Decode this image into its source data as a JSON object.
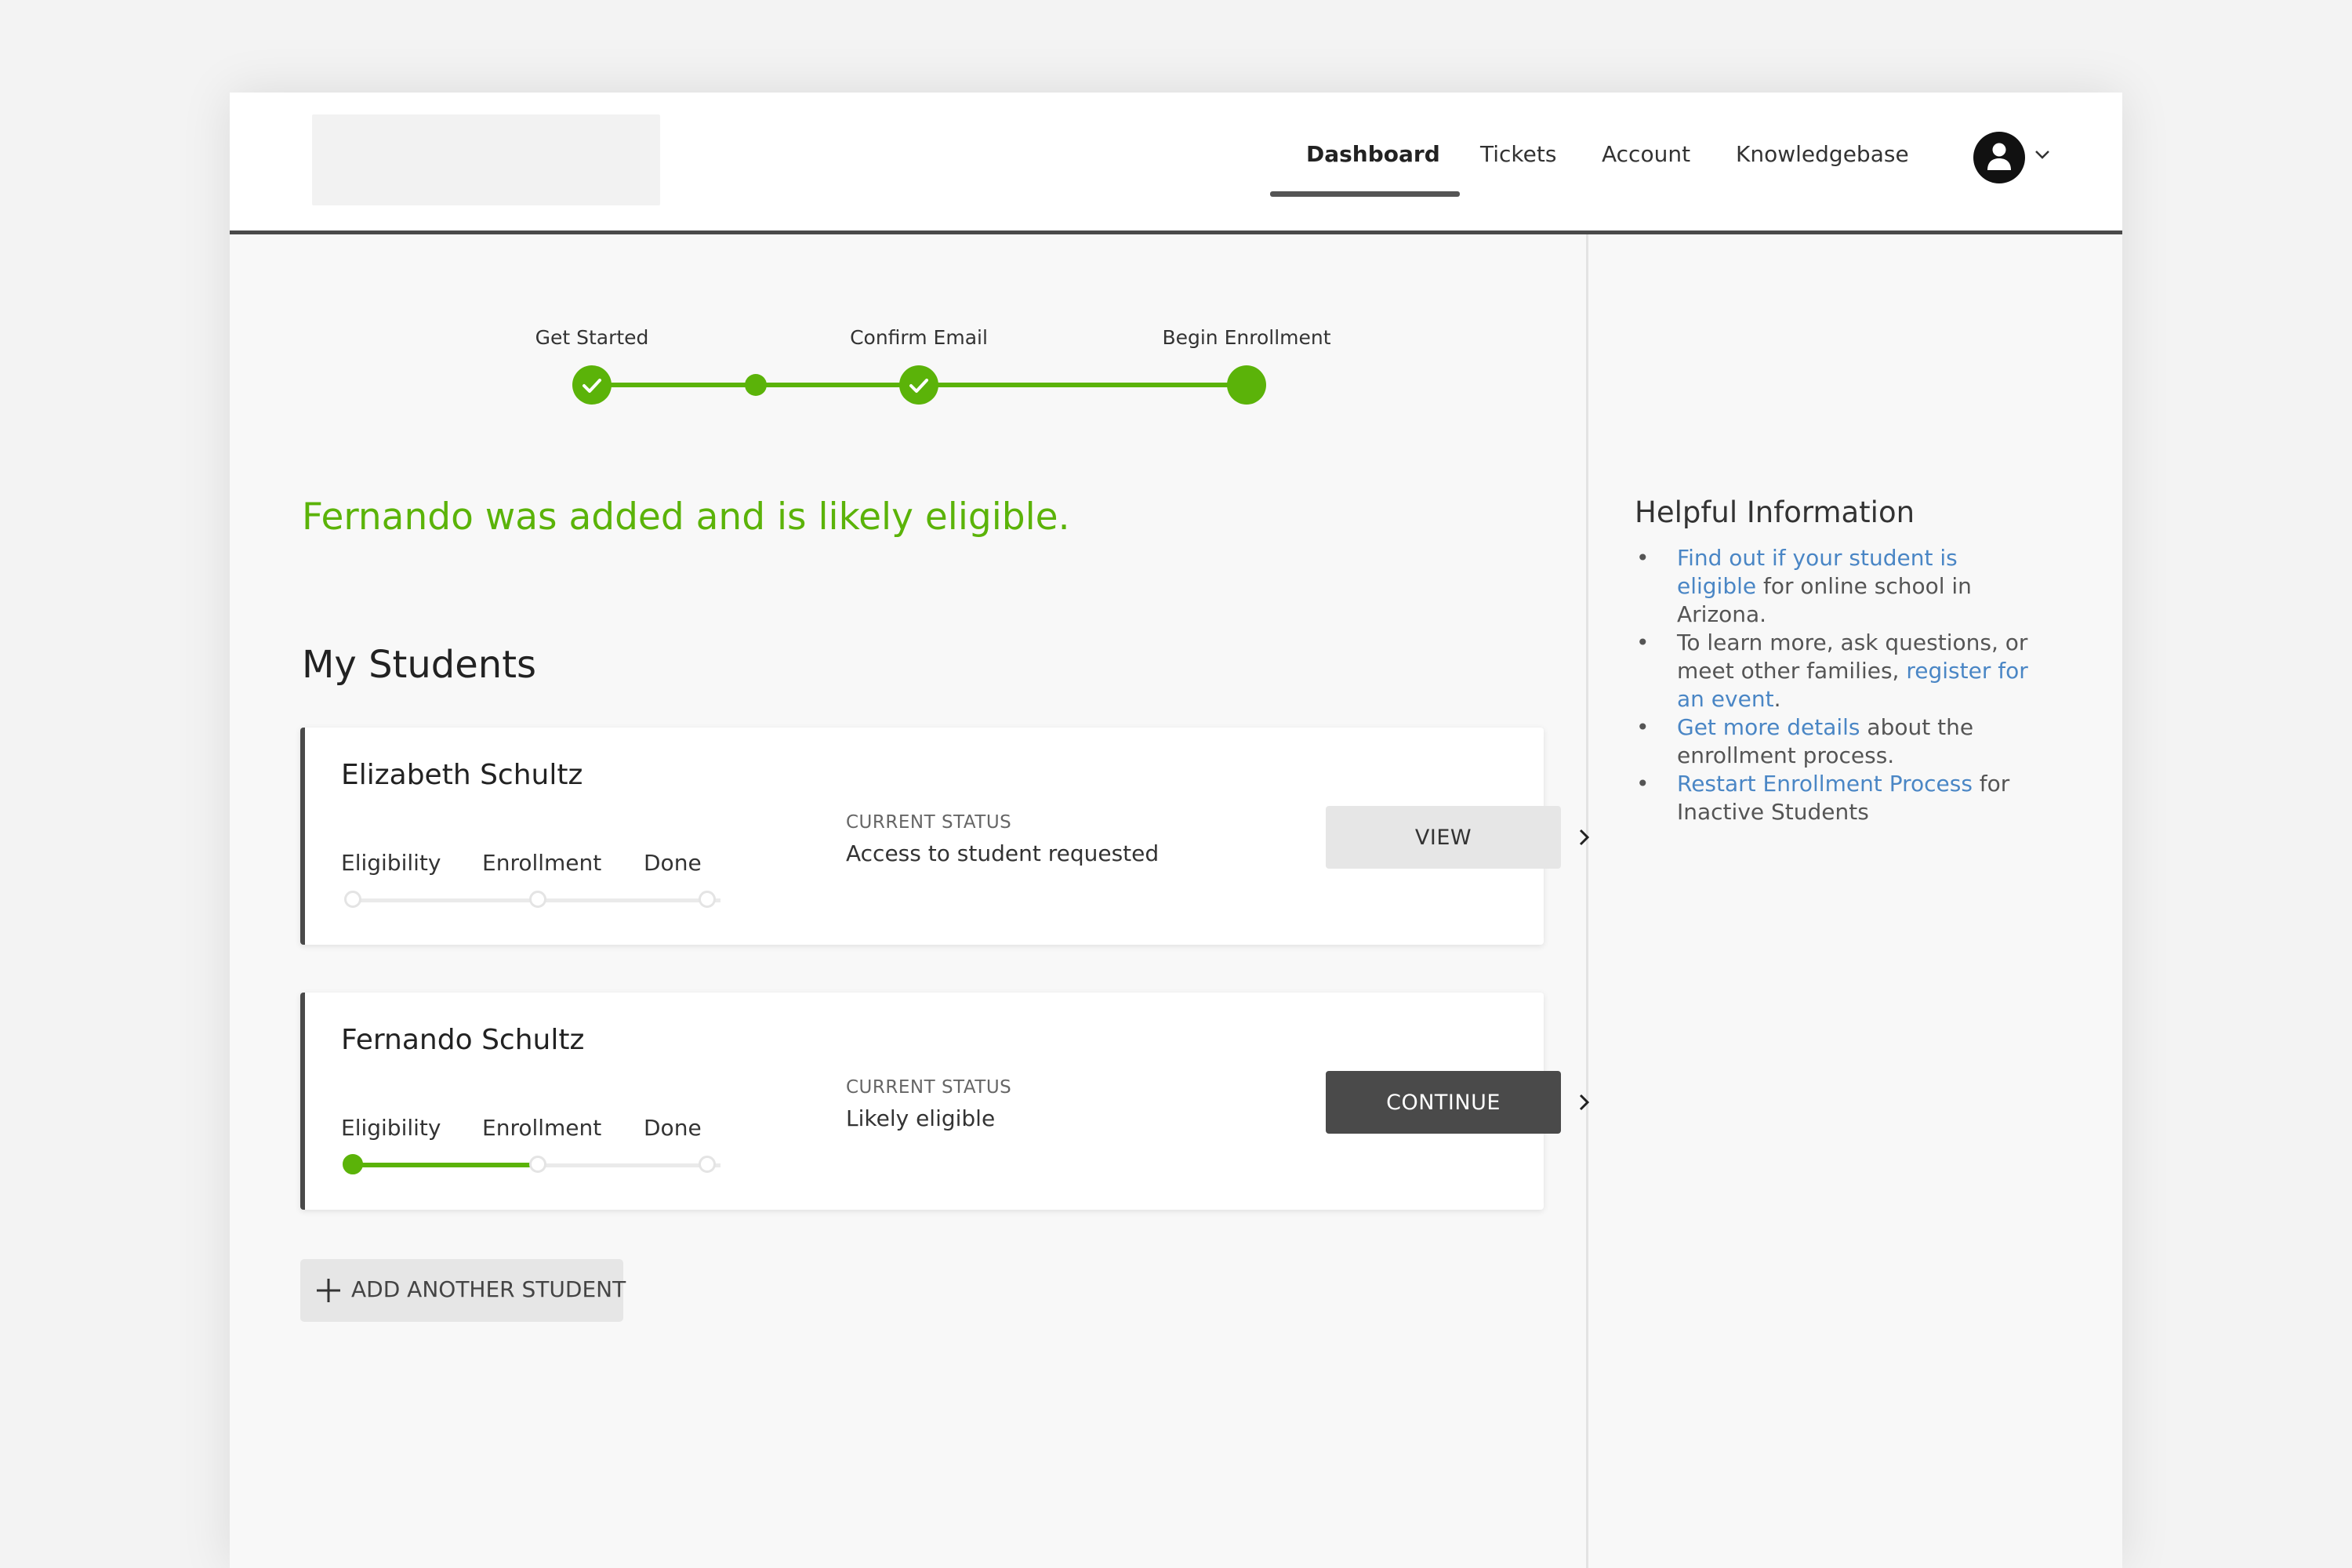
{
  "nav": {
    "items": [
      {
        "label": "Dashboard",
        "active": true
      },
      {
        "label": "Tickets",
        "active": false
      },
      {
        "label": "Account",
        "active": false
      },
      {
        "label": "Knowledgebase",
        "active": false
      }
    ],
    "user_icon": "user-avatar-icon",
    "dropdown_icon": "chevron-down-icon"
  },
  "stepper": {
    "steps": [
      {
        "label": "Get Started",
        "state": "complete"
      },
      {
        "label": "",
        "state": "intermediate"
      },
      {
        "label": "Confirm Email",
        "state": "complete"
      },
      {
        "label": "Begin Enrollment",
        "state": "current"
      }
    ]
  },
  "message": "Fernando was added and is likely eligible.",
  "students_title": "My Students",
  "students": [
    {
      "name": "Elizabeth Schultz",
      "progress_labels": [
        "Eligibility",
        "Enrollment",
        "Done"
      ],
      "progress_completed": 0,
      "status_label": "CURRENT STATUS",
      "status": "Access to student requested",
      "action": "VIEW",
      "action_style": "light"
    },
    {
      "name": "Fernando Schultz",
      "progress_labels": [
        "Eligibility",
        "Enrollment",
        "Done"
      ],
      "progress_completed": 1,
      "status_label": "CURRENT STATUS",
      "status": "Likely eligible",
      "action": "CONTINUE",
      "action_style": "dark"
    }
  ],
  "add_student": "ADD ANOTHER STUDENT",
  "help": {
    "title": "Helpful Information",
    "items": [
      {
        "link": "Find out if your student is eligible",
        "after": " for online school in Arizona."
      },
      {
        "before": "To learn more, ask questions, or meet other families, ",
        "link": "register for an event",
        "after": "."
      },
      {
        "link": "Get more details",
        "after": " about the enrollment process."
      },
      {
        "link": "Restart Enrollment Process",
        "after": " for Inactive Students"
      }
    ]
  },
  "colors": {
    "accent_green": "#5bb309",
    "link_blue": "#4a86c5",
    "dark_button": "#4a4a4a"
  }
}
